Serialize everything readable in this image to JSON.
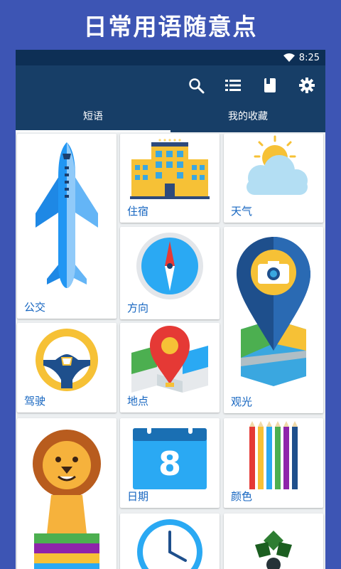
{
  "banner": {
    "title": "日常用语随意点"
  },
  "status": {
    "time": "8:25"
  },
  "toolbar": {
    "icons": [
      "search-icon",
      "list-icon",
      "book-icon",
      "settings-icon"
    ]
  },
  "tabs": [
    {
      "label": "短语",
      "active": true
    },
    {
      "label": "我的收藏",
      "active": false
    }
  ],
  "categories": [
    {
      "label": "住宿",
      "icon": "hotel-icon"
    },
    {
      "label": "天气",
      "icon": "weather-icon"
    },
    {
      "label": "公交",
      "icon": "airplane-icon"
    },
    {
      "label": "方向",
      "icon": "compass-icon"
    },
    {
      "label": "驾驶",
      "icon": "steering-wheel-icon"
    },
    {
      "label": "地点",
      "icon": "map-pin-icon"
    },
    {
      "label": "观光",
      "icon": "camera-pin-icon"
    },
    {
      "label": "日期",
      "icon": "calendar-icon"
    },
    {
      "label": "颜色",
      "icon": "colored-pencils-icon"
    },
    {
      "label": "",
      "icon": "lion-icon"
    },
    {
      "label": "",
      "icon": "clock-icon"
    },
    {
      "label": "",
      "icon": "plant-icon"
    }
  ],
  "calendar": {
    "day": "8"
  },
  "colors": {
    "banner": "#3d55b4",
    "appbar": "#173e67",
    "statusbar": "#0d2f55",
    "label": "#1565c0"
  }
}
